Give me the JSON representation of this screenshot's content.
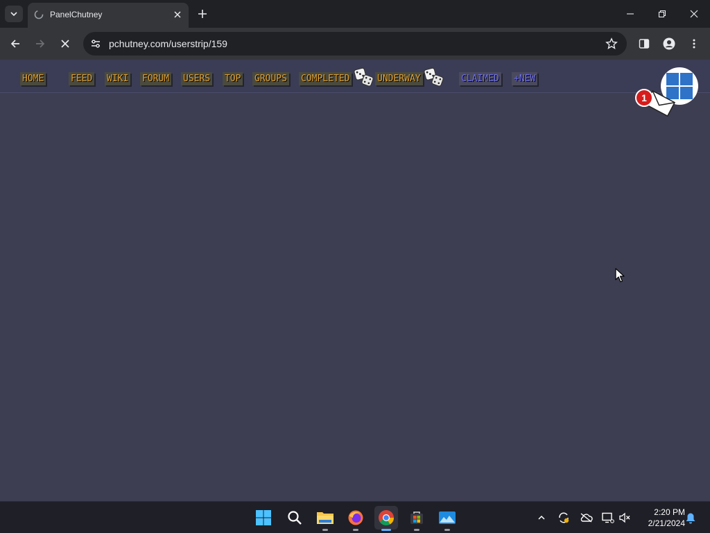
{
  "browser": {
    "tab_title": "PanelChutney",
    "url": "pchutney.com/userstrip/159"
  },
  "site_nav": {
    "home": "HOME",
    "feed": "FEED",
    "wiki": "WIKI",
    "forum": "FORUM",
    "users": "USERS",
    "top": "TOP",
    "groups": "GROUPS",
    "completed": "COMPLETED",
    "underway": "UNDERWAY",
    "claimed": "CLAIMED",
    "new": "+NEW"
  },
  "notifications": {
    "count": "1"
  },
  "taskbar": {
    "time": "2:20 PM",
    "date": "2/21/2024"
  },
  "colors": {
    "page_background": "#3e3e52",
    "nav_link": "#e0a030",
    "nav_link_alt": "#6f6ff5",
    "badge": "#d61c1c"
  }
}
